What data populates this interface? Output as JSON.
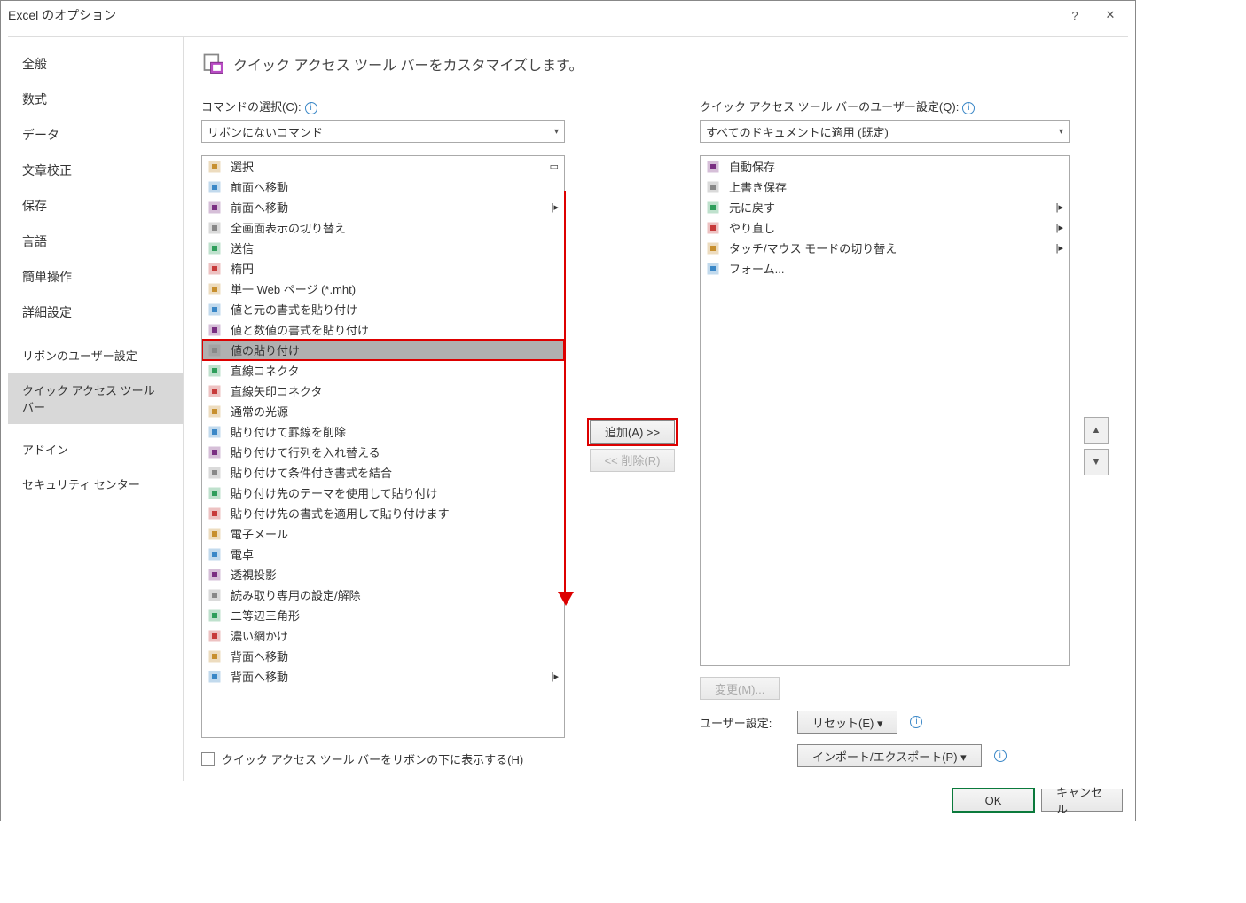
{
  "title": "Excel のオプション",
  "sidebar": {
    "items": [
      {
        "label": "全般"
      },
      {
        "label": "数式"
      },
      {
        "label": "データ"
      },
      {
        "label": "文章校正"
      },
      {
        "label": "保存"
      },
      {
        "label": "言語"
      },
      {
        "label": "簡単操作"
      },
      {
        "label": "詳細設定"
      },
      {
        "label": "リボンのユーザー設定"
      },
      {
        "label": "クイック アクセス ツール バー",
        "active": true
      },
      {
        "label": "アドイン"
      },
      {
        "label": "セキュリティ センター"
      }
    ]
  },
  "heading": "クイック アクセス ツール バーをカスタマイズします。",
  "left": {
    "label": "コマンドの選択(C):",
    "dropdown": "リボンにないコマンド",
    "items": [
      {
        "label": "選択",
        "glyph": "▭"
      },
      {
        "label": "前面へ移動"
      },
      {
        "label": "前面へ移動",
        "sub": true
      },
      {
        "label": "全画面表示の切り替え"
      },
      {
        "label": "送信"
      },
      {
        "label": "楕円"
      },
      {
        "label": "単一 Web ページ (*.mht)"
      },
      {
        "label": "値と元の書式を貼り付け"
      },
      {
        "label": "値と数値の書式を貼り付け"
      },
      {
        "label": "値の貼り付け",
        "selected": true
      },
      {
        "label": "直線コネクタ"
      },
      {
        "label": "直線矢印コネクタ"
      },
      {
        "label": "通常の光源"
      },
      {
        "label": "貼り付けて罫線を削除"
      },
      {
        "label": "貼り付けて行列を入れ替える"
      },
      {
        "label": "貼り付けて条件付き書式を結合"
      },
      {
        "label": "貼り付け先のテーマを使用して貼り付け"
      },
      {
        "label": "貼り付け先の書式を適用して貼り付けます"
      },
      {
        "label": "電子メール"
      },
      {
        "label": "電卓"
      },
      {
        "label": "透視投影"
      },
      {
        "label": "読み取り専用の設定/解除"
      },
      {
        "label": "二等辺三角形"
      },
      {
        "label": "濃い網かけ"
      },
      {
        "label": "背面へ移動"
      },
      {
        "label": "背面へ移動",
        "sub": true
      }
    ],
    "checkbox_label": "クイック アクセス ツール バーをリボンの下に表示する(H)"
  },
  "mid": {
    "add": "追加(A) >>",
    "remove": "<< 削除(R)"
  },
  "right": {
    "label": "クイック アクセス ツール バーのユーザー設定(Q):",
    "dropdown": "すべてのドキュメントに適用 (既定)",
    "items": [
      {
        "label": "自動保存"
      },
      {
        "label": "上書き保存"
      },
      {
        "label": "元に戻す",
        "sub": true
      },
      {
        "label": "やり直し",
        "sub": true
      },
      {
        "label": "タッチ/マウス モードの切り替え",
        "sub": true
      },
      {
        "label": "フォーム..."
      }
    ],
    "modify": "変更(M)...",
    "user_label": "ユーザー設定:",
    "reset": "リセット(E) ▾",
    "import_export": "インポート/エクスポート(P) ▾"
  },
  "footer": {
    "ok": "OK",
    "cancel": "キャンセル"
  }
}
